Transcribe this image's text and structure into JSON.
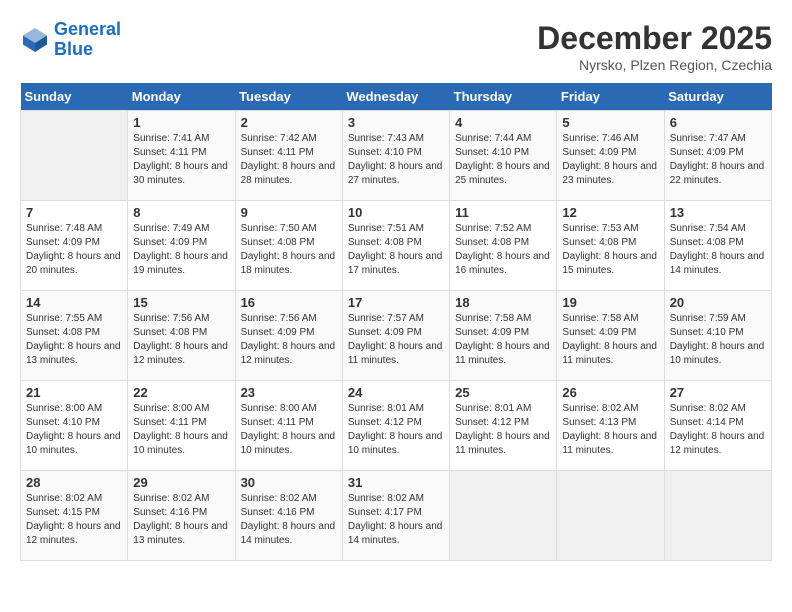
{
  "header": {
    "logo_line1": "General",
    "logo_line2": "Blue",
    "month_title": "December 2025",
    "location": "Nyrsko, Plzen Region, Czechia"
  },
  "weekdays": [
    "Sunday",
    "Monday",
    "Tuesday",
    "Wednesday",
    "Thursday",
    "Friday",
    "Saturday"
  ],
  "weeks": [
    [
      {
        "day": "",
        "empty": true
      },
      {
        "day": "1",
        "sunrise": "7:41 AM",
        "sunset": "4:11 PM",
        "daylight": "8 hours and 30 minutes."
      },
      {
        "day": "2",
        "sunrise": "7:42 AM",
        "sunset": "4:11 PM",
        "daylight": "8 hours and 28 minutes."
      },
      {
        "day": "3",
        "sunrise": "7:43 AM",
        "sunset": "4:10 PM",
        "daylight": "8 hours and 27 minutes."
      },
      {
        "day": "4",
        "sunrise": "7:44 AM",
        "sunset": "4:10 PM",
        "daylight": "8 hours and 25 minutes."
      },
      {
        "day": "5",
        "sunrise": "7:46 AM",
        "sunset": "4:09 PM",
        "daylight": "8 hours and 23 minutes."
      },
      {
        "day": "6",
        "sunrise": "7:47 AM",
        "sunset": "4:09 PM",
        "daylight": "8 hours and 22 minutes."
      }
    ],
    [
      {
        "day": "7",
        "sunrise": "7:48 AM",
        "sunset": "4:09 PM",
        "daylight": "8 hours and 20 minutes."
      },
      {
        "day": "8",
        "sunrise": "7:49 AM",
        "sunset": "4:09 PM",
        "daylight": "8 hours and 19 minutes."
      },
      {
        "day": "9",
        "sunrise": "7:50 AM",
        "sunset": "4:08 PM",
        "daylight": "8 hours and 18 minutes."
      },
      {
        "day": "10",
        "sunrise": "7:51 AM",
        "sunset": "4:08 PM",
        "daylight": "8 hours and 17 minutes."
      },
      {
        "day": "11",
        "sunrise": "7:52 AM",
        "sunset": "4:08 PM",
        "daylight": "8 hours and 16 minutes."
      },
      {
        "day": "12",
        "sunrise": "7:53 AM",
        "sunset": "4:08 PM",
        "daylight": "8 hours and 15 minutes."
      },
      {
        "day": "13",
        "sunrise": "7:54 AM",
        "sunset": "4:08 PM",
        "daylight": "8 hours and 14 minutes."
      }
    ],
    [
      {
        "day": "14",
        "sunrise": "7:55 AM",
        "sunset": "4:08 PM",
        "daylight": "8 hours and 13 minutes."
      },
      {
        "day": "15",
        "sunrise": "7:56 AM",
        "sunset": "4:08 PM",
        "daylight": "8 hours and 12 minutes."
      },
      {
        "day": "16",
        "sunrise": "7:56 AM",
        "sunset": "4:09 PM",
        "daylight": "8 hours and 12 minutes."
      },
      {
        "day": "17",
        "sunrise": "7:57 AM",
        "sunset": "4:09 PM",
        "daylight": "8 hours and 11 minutes."
      },
      {
        "day": "18",
        "sunrise": "7:58 AM",
        "sunset": "4:09 PM",
        "daylight": "8 hours and 11 minutes."
      },
      {
        "day": "19",
        "sunrise": "7:58 AM",
        "sunset": "4:09 PM",
        "daylight": "8 hours and 11 minutes."
      },
      {
        "day": "20",
        "sunrise": "7:59 AM",
        "sunset": "4:10 PM",
        "daylight": "8 hours and 10 minutes."
      }
    ],
    [
      {
        "day": "21",
        "sunrise": "8:00 AM",
        "sunset": "4:10 PM",
        "daylight": "8 hours and 10 minutes."
      },
      {
        "day": "22",
        "sunrise": "8:00 AM",
        "sunset": "4:11 PM",
        "daylight": "8 hours and 10 minutes."
      },
      {
        "day": "23",
        "sunrise": "8:00 AM",
        "sunset": "4:11 PM",
        "daylight": "8 hours and 10 minutes."
      },
      {
        "day": "24",
        "sunrise": "8:01 AM",
        "sunset": "4:12 PM",
        "daylight": "8 hours and 10 minutes."
      },
      {
        "day": "25",
        "sunrise": "8:01 AM",
        "sunset": "4:12 PM",
        "daylight": "8 hours and 11 minutes."
      },
      {
        "day": "26",
        "sunrise": "8:02 AM",
        "sunset": "4:13 PM",
        "daylight": "8 hours and 11 minutes."
      },
      {
        "day": "27",
        "sunrise": "8:02 AM",
        "sunset": "4:14 PM",
        "daylight": "8 hours and 12 minutes."
      }
    ],
    [
      {
        "day": "28",
        "sunrise": "8:02 AM",
        "sunset": "4:15 PM",
        "daylight": "8 hours and 12 minutes."
      },
      {
        "day": "29",
        "sunrise": "8:02 AM",
        "sunset": "4:16 PM",
        "daylight": "8 hours and 13 minutes."
      },
      {
        "day": "30",
        "sunrise": "8:02 AM",
        "sunset": "4:16 PM",
        "daylight": "8 hours and 14 minutes."
      },
      {
        "day": "31",
        "sunrise": "8:02 AM",
        "sunset": "4:17 PM",
        "daylight": "8 hours and 14 minutes."
      },
      {
        "day": "",
        "empty": true
      },
      {
        "day": "",
        "empty": true
      },
      {
        "day": "",
        "empty": true
      }
    ]
  ]
}
